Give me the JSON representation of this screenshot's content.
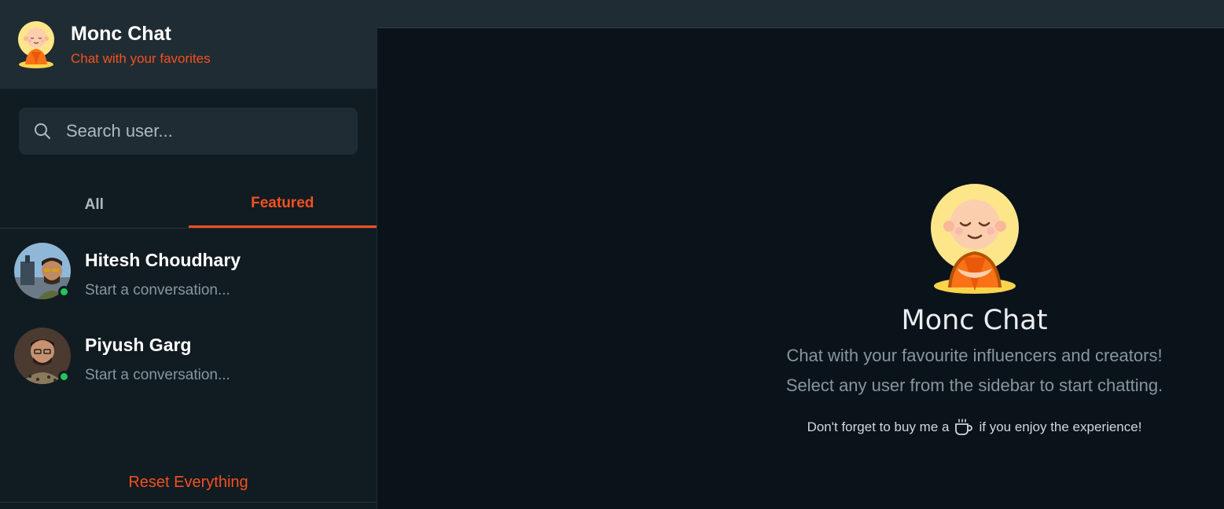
{
  "brand": {
    "title": "Monc Chat",
    "subtitle": "Chat with your favorites",
    "logo_icon": "monk-logo-icon",
    "accent_color": "#f4511e"
  },
  "search": {
    "placeholder": "Search user...",
    "value": ""
  },
  "tabs": [
    {
      "label": "All",
      "active": false
    },
    {
      "label": "Featured",
      "active": true
    }
  ],
  "users": [
    {
      "name": "Hitesh Choudhary",
      "preview": "Start a conversation...",
      "online": true
    },
    {
      "name": "Piyush Garg",
      "preview": "Start a conversation...",
      "online": true
    }
  ],
  "sidebar_footer": {
    "reset_label": "Reset Everything"
  },
  "welcome": {
    "title": "Monc Chat",
    "line1": "Chat with your favourite influencers and creators!",
    "line2": "Select any user from the sidebar to start chatting.",
    "coffee_prefix": "Don't forget to buy me a",
    "coffee_suffix": "if you enjoy the experience!",
    "coffee_icon": "coffee-cup-icon"
  }
}
